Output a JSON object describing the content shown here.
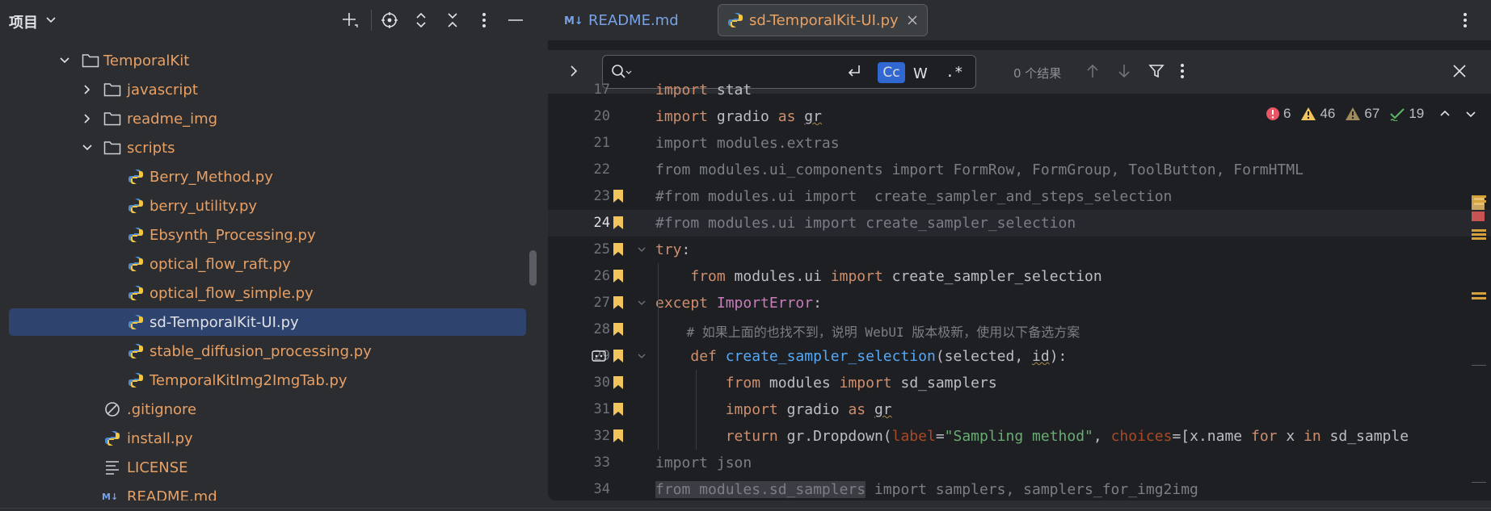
{
  "project_panel": {
    "title": "项目",
    "tree": [
      {
        "label": "TemporalKit",
        "type": "folder",
        "expanded": true,
        "depth": 0,
        "color": "orange"
      },
      {
        "label": "javascript",
        "type": "folder",
        "expanded": false,
        "depth": 1,
        "color": "orange"
      },
      {
        "label": "readme_img",
        "type": "folder",
        "expanded": false,
        "depth": 1,
        "color": "orange"
      },
      {
        "label": "scripts",
        "type": "folder",
        "expanded": true,
        "depth": 1,
        "color": "orange"
      },
      {
        "label": "Berry_Method.py",
        "type": "python",
        "depth": 2,
        "color": "orange"
      },
      {
        "label": "berry_utility.py",
        "type": "python",
        "depth": 2,
        "color": "orange"
      },
      {
        "label": "Ebsynth_Processing.py",
        "type": "python",
        "depth": 2,
        "color": "orange"
      },
      {
        "label": "optical_flow_raft.py",
        "type": "python",
        "depth": 2,
        "color": "orange"
      },
      {
        "label": "optical_flow_simple.py",
        "type": "python",
        "depth": 2,
        "color": "orange"
      },
      {
        "label": "sd-TemporalKit-UI.py",
        "type": "python",
        "depth": 2,
        "color": "white",
        "selected": true
      },
      {
        "label": "stable_diffusion_processing.py",
        "type": "python",
        "depth": 2,
        "color": "orange"
      },
      {
        "label": "TemporalKitImg2ImgTab.py",
        "type": "python",
        "depth": 2,
        "color": "orange"
      },
      {
        "label": ".gitignore",
        "type": "ignore",
        "depth": 1,
        "color": "orange"
      },
      {
        "label": "install.py",
        "type": "python",
        "depth": 1,
        "color": "orange"
      },
      {
        "label": "LICENSE",
        "type": "text",
        "depth": 1,
        "color": "orange"
      },
      {
        "label": "README.md",
        "type": "markdown",
        "depth": 1,
        "color": "orange"
      }
    ]
  },
  "tabs": [
    {
      "label": "README.md",
      "icon": "markdown-icon",
      "active": false
    },
    {
      "label": "sd-TemporalKit-UI.py",
      "icon": "python-icon",
      "active": true
    }
  ],
  "find_bar": {
    "query": "",
    "match_case_label": "Cc",
    "words_label": "W",
    "regex_label": ".*",
    "results": "0 个结果"
  },
  "inspections": {
    "errors": "6",
    "warnings": "46",
    "weak_warnings": "67",
    "typos": "19"
  },
  "editor": {
    "current_line": 24,
    "lines": [
      {
        "n": "17",
        "text": "import stat"
      },
      {
        "n": "20",
        "text": "import gradio as gr"
      },
      {
        "n": "21",
        "text": "import modules.extras"
      },
      {
        "n": "22",
        "text": "from modules.ui_components import FormRow, FormGroup, ToolButton, FormHTML"
      },
      {
        "n": "23",
        "text": "#from modules.ui import  create_sampler_and_steps_selection"
      },
      {
        "n": "24",
        "text": "#from modules.ui import create_sampler_selection"
      },
      {
        "n": "25",
        "text": "try:"
      },
      {
        "n": "26",
        "text": "    from modules.ui import create_sampler_selection"
      },
      {
        "n": "27",
        "text": "except ImportError:"
      },
      {
        "n": "28",
        "text": "    # 如果上面的也找不到，说明 WebUI 版本极新，使用以下备选方案"
      },
      {
        "n": "29",
        "text": "    def create_sampler_selection(selected, id):"
      },
      {
        "n": "30",
        "text": "        from modules import sd_samplers"
      },
      {
        "n": "31",
        "text": "        import gradio as gr"
      },
      {
        "n": "32",
        "text": "        return gr.Dropdown(label=\"Sampling method\", choices=[x.name for x in sd_sample"
      },
      {
        "n": "33",
        "text": "import json"
      },
      {
        "n": "34",
        "text": "from modules.sd_samplers import samplers, samplers_for_img2img"
      }
    ]
  },
  "colors": {
    "bg": "#1e1f22",
    "panel": "#2b2d30",
    "selection": "#2e436e",
    "accent": "#3574f0",
    "keyword": "#cf8e6d",
    "string": "#6aab73",
    "function": "#56a8f5",
    "comment": "#7a7e85",
    "bookmark": "#f2c55c",
    "file_orange": "#e8a065"
  }
}
